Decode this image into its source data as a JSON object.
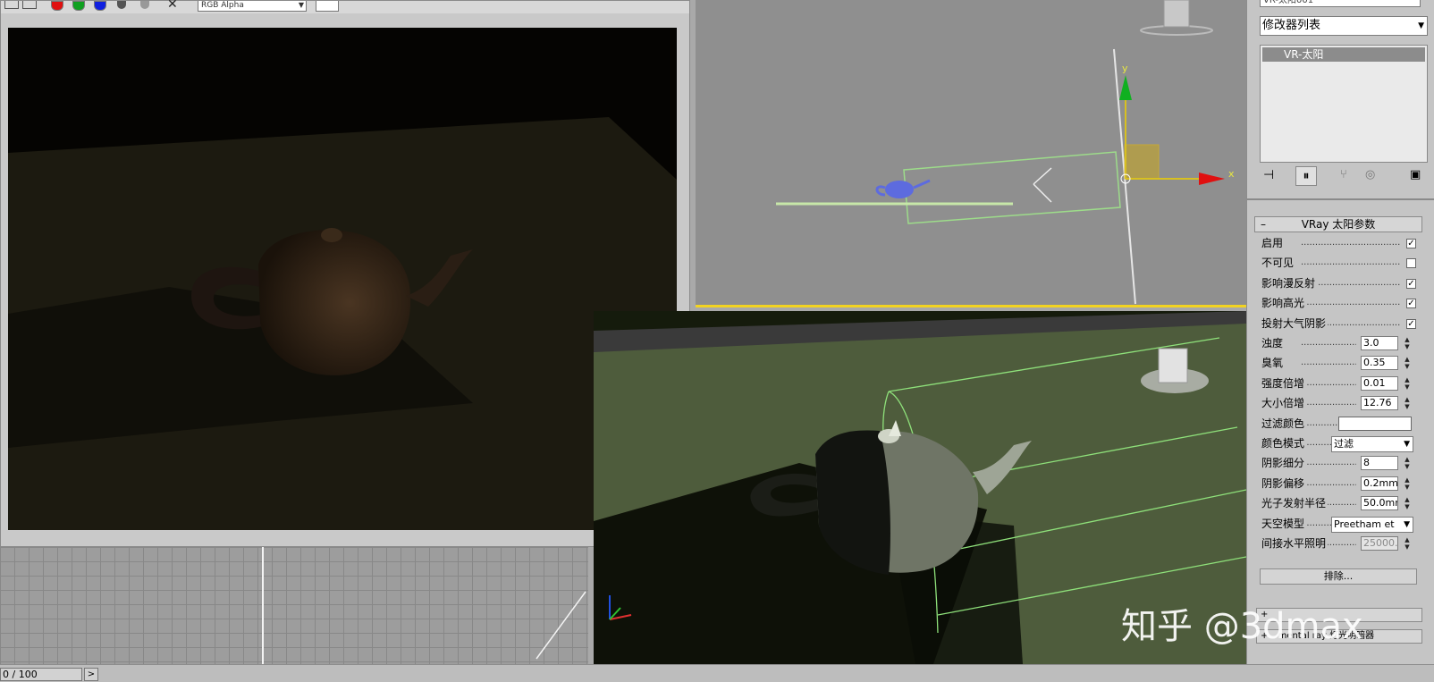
{
  "render_window": {
    "channel_select": "RGB Alpha"
  },
  "viewport_top": {
    "axis_x": "x",
    "axis_y": "y"
  },
  "command_panel": {
    "object_name": "VR-太阳001",
    "modifier_list": "修改器列表",
    "stack_item": "VR-太阳",
    "rollout_title": "VRay 太阳参数",
    "params": [
      {
        "label": "启用",
        "type": "check",
        "checked": true
      },
      {
        "label": "不可见",
        "type": "check",
        "checked": false
      },
      {
        "label": "影响漫反射",
        "type": "check",
        "checked": true
      },
      {
        "label": "影响高光",
        "type": "check",
        "checked": true
      },
      {
        "label": "投射大气阴影",
        "type": "check",
        "checked": true
      },
      {
        "label": "浊度",
        "type": "spin",
        "value": "3.0"
      },
      {
        "label": "臭氧",
        "type": "spin",
        "value": "0.35"
      },
      {
        "label": "强度倍增",
        "type": "spin",
        "value": "0.01"
      },
      {
        "label": "大小倍增",
        "type": "spin",
        "value": "12.76"
      },
      {
        "label": "过滤颜色",
        "type": "color",
        "value": "#ffffff"
      },
      {
        "label": "颜色模式",
        "type": "drop",
        "value": "过滤"
      },
      {
        "label": "阴影细分",
        "type": "spin",
        "value": "8"
      },
      {
        "label": "阴影偏移",
        "type": "spin",
        "value": "0.2mm"
      },
      {
        "label": "光子发射半径",
        "type": "spin",
        "value": "50.0mr"
      },
      {
        "label": "天空模型",
        "type": "drop",
        "value": "Preetham et"
      },
      {
        "label": "间接水平照明",
        "type": "spin",
        "value": "25000.",
        "disabled": true
      }
    ],
    "exclude_button": "排除...",
    "rollout_collapsed_1": "",
    "rollout_collapsed_2": "mental ray 灯光明暗器"
  },
  "status_bar": {
    "time_slider": "0 / 100",
    "next_button": ">"
  },
  "watermark": "知乎 @3dmax",
  "colors": {
    "active_viewport_border": "#f2d321",
    "panel_bg": "#c5c5c5",
    "gizmo_x": "#e01010",
    "gizmo_y": "#10b020",
    "gizmo_plane": "#d4b020"
  }
}
